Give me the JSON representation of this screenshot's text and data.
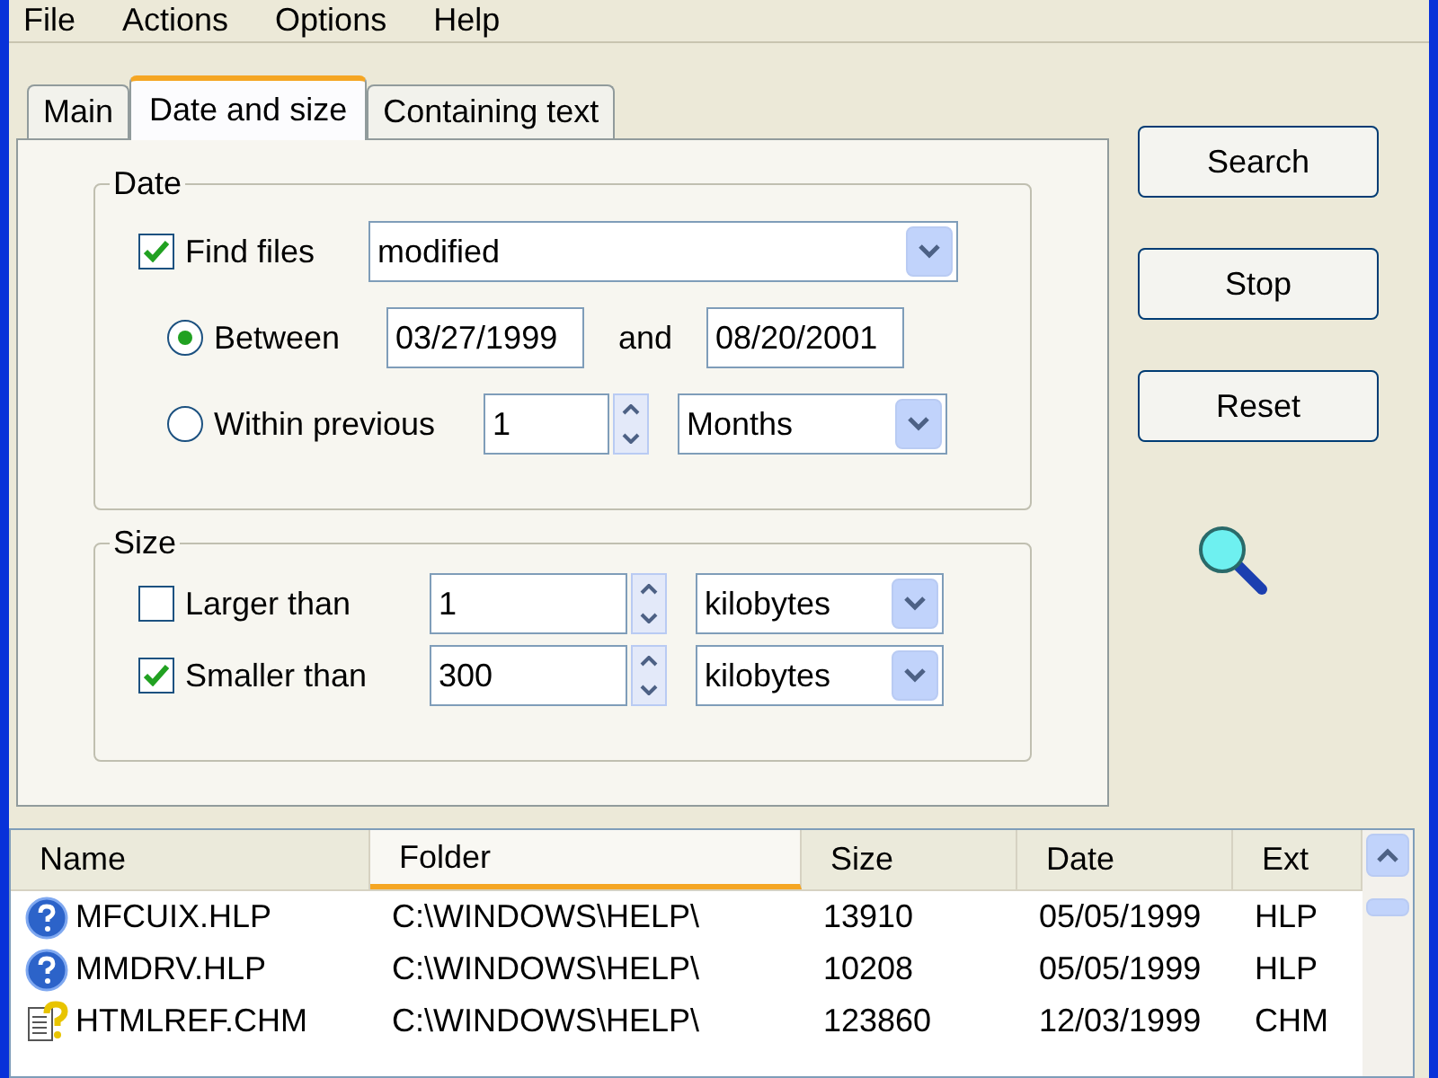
{
  "menu": [
    "File",
    "Actions",
    "Options",
    "Help"
  ],
  "tabs": [
    {
      "label": "Main",
      "selected": false
    },
    {
      "label": "Date and size",
      "selected": true
    },
    {
      "label": "Containing text",
      "selected": false
    }
  ],
  "date_group": {
    "title": "Date",
    "find_files": {
      "label": "Find files",
      "checked": true,
      "value": "modified"
    },
    "options": [
      {
        "kind": "range",
        "label": "Between",
        "selected": true,
        "from": "03/27/1999",
        "joiner": "and",
        "to": "08/20/2001"
      },
      {
        "kind": "previous",
        "label": "Within previous",
        "selected": false,
        "count": "1",
        "unit": "Months"
      }
    ]
  },
  "size_group": {
    "title": "Size",
    "rows": [
      {
        "label": "Larger than",
        "checked": false,
        "value": "1",
        "unit": "kilobytes"
      },
      {
        "label": "Smaller than",
        "checked": true,
        "value": "300",
        "unit": "kilobytes"
      }
    ]
  },
  "buttons": [
    "Search",
    "Stop",
    "Reset"
  ],
  "results": {
    "columns": [
      {
        "label": "Name",
        "sorted": false
      },
      {
        "label": "Folder",
        "sorted": true
      },
      {
        "label": "Size",
        "sorted": false
      },
      {
        "label": "Date",
        "sorted": false
      },
      {
        "label": "Ext",
        "sorted": false
      }
    ],
    "rows": [
      {
        "kind": "help",
        "cells": [
          "MFCUIX.HLP",
          "C:\\WINDOWS\\HELP\\",
          "13910",
          "05/05/1999",
          "HLP"
        ]
      },
      {
        "kind": "help",
        "cells": [
          "MMDRV.HLP",
          "C:\\WINDOWS\\HELP\\",
          "10208",
          "05/05/1999",
          "HLP"
        ]
      },
      {
        "kind": "chm",
        "cells": [
          "HTMLREF.CHM",
          "C:\\WINDOWS\\HELP\\",
          "123860",
          "12/03/1999",
          "CHM"
        ]
      }
    ]
  }
}
